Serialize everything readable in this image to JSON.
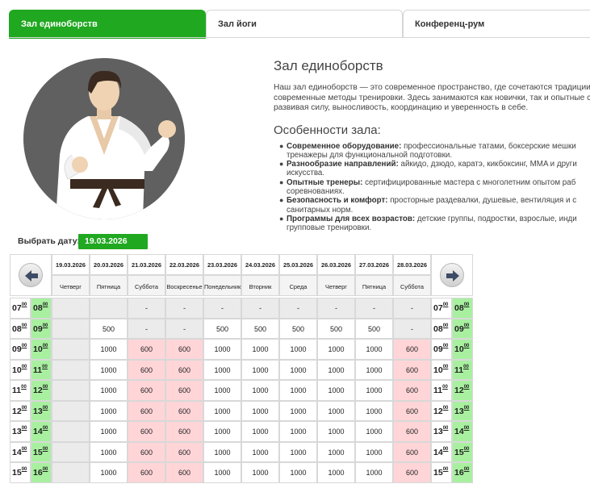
{
  "tabs": [
    {
      "label": "Зал единоборств",
      "active": true
    },
    {
      "label": "Зал йоги",
      "active": false
    },
    {
      "label": "Конференц-рум",
      "active": false
    }
  ],
  "hall": {
    "title": "Зал единоборств",
    "description_lines": [
      "Наш зал единоборств — это современное пространство, где сочетаются традиции б",
      "современные методы тренировки. Здесь занимаются как новички, так и опытные сп",
      "развивая силу, выносливость, координацию и уверенность в себе."
    ],
    "features_title": "Особенности зала:",
    "features": [
      {
        "bold": "Современное оборудование:",
        "text": " профессиональные татами, боксерские мешки",
        "cont": "тренажеры для функциональной подготовки."
      },
      {
        "bold": "Разнообразие направлений:",
        "text": " айкидо, дзюдо, каратэ, кикбоксинг, MMA и други",
        "cont": "искусства."
      },
      {
        "bold": "Опытные тренеры:",
        "text": " сертифицированные мастера с многолетним опытом раб",
        "cont": "соревнованиях."
      },
      {
        "bold": "Безопасность и комфорт:",
        "text": " просторные раздевалки, душевые, вентиляция и с",
        "cont": "санитарных норм."
      },
      {
        "bold": "Программы для всех возрастов:",
        "text": " детские группы, подростки, взрослые, инди",
        "cont": "групповые тренировки."
      }
    ]
  },
  "date_picker": {
    "label": "Выбрать дату:",
    "value": "19.03.2026"
  },
  "schedule": {
    "dates": [
      "19.03.2026",
      "20.03.2026",
      "21.03.2026",
      "22.03.2026",
      "23.03.2026",
      "24.03.2026",
      "25.03.2026",
      "26.03.2026",
      "27.03.2026",
      "28.03.2026"
    ],
    "weekdays": [
      "Четверг",
      "Пятница",
      "Суббота",
      "Воскресенье",
      "Понедельник",
      "Вторник",
      "Среда",
      "Четверг",
      "Пятница",
      "Суббота"
    ],
    "day_types": [
      "past",
      "work",
      "weekend",
      "weekend",
      "work",
      "work",
      "work",
      "work",
      "work",
      "weekend"
    ],
    "rows": [
      {
        "start": "07",
        "end": "08",
        "prices": [
          "",
          "",
          "-",
          "-",
          "-",
          "-",
          "-",
          "-",
          "-",
          "-"
        ]
      },
      {
        "start": "08",
        "end": "09",
        "prices": [
          "",
          "500",
          "-",
          "-",
          "500",
          "500",
          "500",
          "500",
          "500",
          "-"
        ]
      },
      {
        "start": "09",
        "end": "10",
        "prices": [
          "",
          "1000",
          "600",
          "600",
          "1000",
          "1000",
          "1000",
          "1000",
          "1000",
          "600"
        ]
      },
      {
        "start": "10",
        "end": "11",
        "prices": [
          "",
          "1000",
          "600",
          "600",
          "1000",
          "1000",
          "1000",
          "1000",
          "1000",
          "600"
        ]
      },
      {
        "start": "11",
        "end": "12",
        "prices": [
          "",
          "1000",
          "600",
          "600",
          "1000",
          "1000",
          "1000",
          "1000",
          "1000",
          "600"
        ]
      },
      {
        "start": "12",
        "end": "13",
        "prices": [
          "",
          "1000",
          "600",
          "600",
          "1000",
          "1000",
          "1000",
          "1000",
          "1000",
          "600"
        ]
      },
      {
        "start": "13",
        "end": "14",
        "prices": [
          "",
          "1000",
          "600",
          "600",
          "1000",
          "1000",
          "1000",
          "1000",
          "1000",
          "600"
        ]
      },
      {
        "start": "14",
        "end": "15",
        "prices": [
          "",
          "1000",
          "600",
          "600",
          "1000",
          "1000",
          "1000",
          "1000",
          "1000",
          "600"
        ]
      },
      {
        "start": "15",
        "end": "16",
        "prices": [
          "",
          "1000",
          "600",
          "600",
          "1000",
          "1000",
          "1000",
          "1000",
          "1000",
          "600"
        ]
      }
    ],
    "minute_mark": "00",
    "prev_icon": "arrow-left-icon",
    "next_icon": "arrow-right-icon"
  },
  "colors": {
    "accent": "#21a821",
    "weekend": "#ffd5d8",
    "past": "#ebebeb",
    "time_green": "#a8f0a0"
  }
}
